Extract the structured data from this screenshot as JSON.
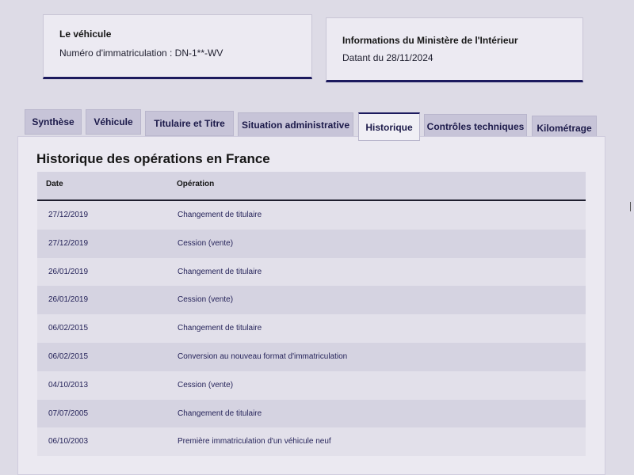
{
  "vehicle_card": {
    "title": "Le véhicule",
    "registration": "Numéro d'immatriculation : DN-1**-WV"
  },
  "ministry_card": {
    "title": "Informations du Ministère de l'Intérieur",
    "date": "Datant du 28/11/2024"
  },
  "tabs": [
    {
      "label": "Synthèse"
    },
    {
      "label": "Véhicule"
    },
    {
      "label": "Titulaire et Titre"
    },
    {
      "label": "Situation administrative"
    },
    {
      "label": "Historique"
    },
    {
      "label": "Contrôles techniques"
    },
    {
      "label": "Kilométrage"
    }
  ],
  "active_tab": "Historique",
  "history": {
    "title": "Historique des opérations en France",
    "columns": {
      "date": "Date",
      "operation": "Opération"
    },
    "rows": [
      {
        "date": "27/12/2019",
        "operation": "Changement de titulaire"
      },
      {
        "date": "27/12/2019",
        "operation": "Cession (vente)"
      },
      {
        "date": "26/01/2019",
        "operation": "Changement de titulaire"
      },
      {
        "date": "26/01/2019",
        "operation": "Cession (vente)"
      },
      {
        "date": "06/02/2015",
        "operation": "Changement de titulaire"
      },
      {
        "date": "06/02/2015",
        "operation": "Conversion au nouveau format d'immatriculation"
      },
      {
        "date": "04/10/2013",
        "operation": "Cession (vente)"
      },
      {
        "date": "07/07/2005",
        "operation": "Changement de titulaire"
      },
      {
        "date": "06/10/2003",
        "operation": "Première immatriculation d'un véhicule neuf"
      }
    ]
  },
  "colors": {
    "accent": "#1c1a5e",
    "background": "#dddbe6"
  }
}
